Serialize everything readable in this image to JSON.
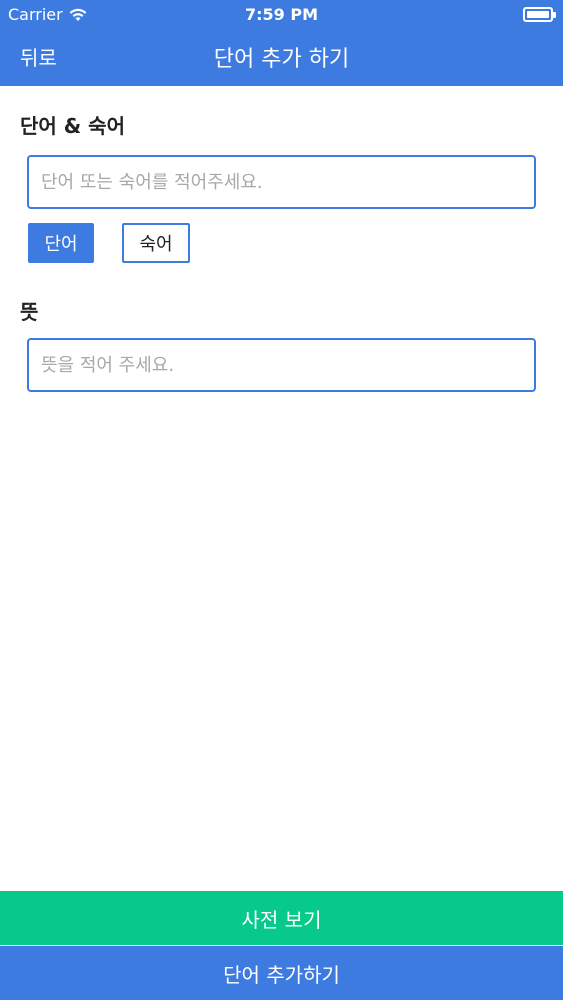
{
  "status_bar": {
    "carrier": "Carrier",
    "time": "7:59 PM"
  },
  "nav": {
    "back_label": "뒤로",
    "title": "단어 추가 하기"
  },
  "word_section": {
    "label": "단어 & 숙어",
    "input_value": "",
    "input_placeholder": "단어 또는 숙어를 적어주세요.",
    "type_options": [
      {
        "label": "단어",
        "selected": true
      },
      {
        "label": "숙어",
        "selected": false
      }
    ]
  },
  "meaning_section": {
    "label": "뜻",
    "input_value": "",
    "input_placeholder": "뜻을 적어 주세요."
  },
  "bottom": {
    "dictionary_label": "사전 보기",
    "add_label": "단어 추가하기"
  },
  "colors": {
    "primary": "#3e7be0",
    "accent_green": "#07c98a"
  },
  "icons": {
    "wifi": "wifi-icon",
    "battery": "battery-icon"
  }
}
